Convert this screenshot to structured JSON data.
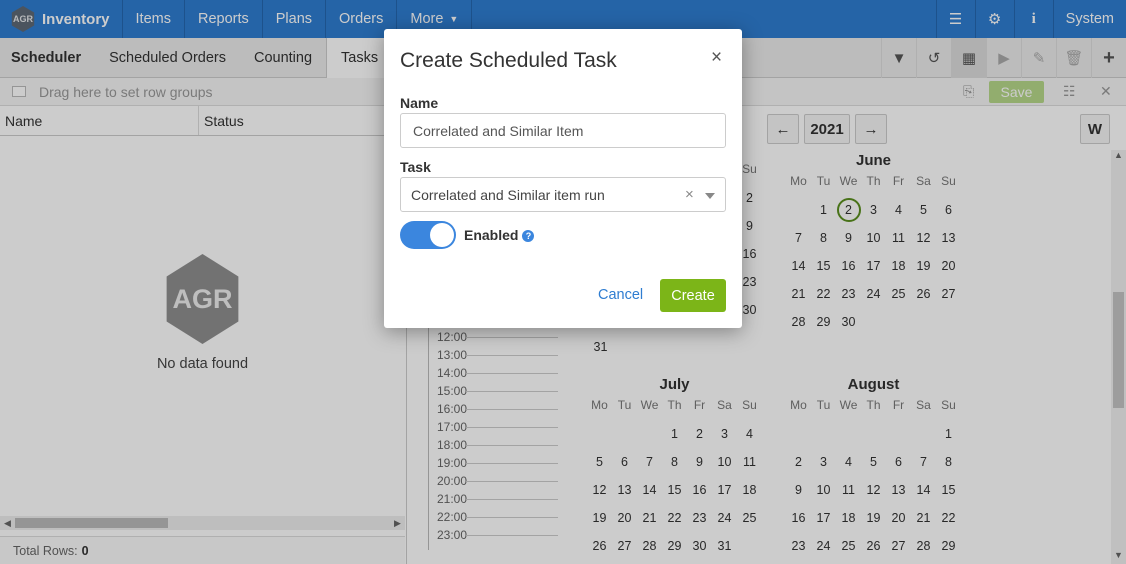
{
  "nav": {
    "logo": "AGR",
    "app": "Inventory",
    "items": [
      "Items",
      "Reports",
      "Plans",
      "Orders",
      "More"
    ],
    "system": "System",
    "icons": [
      "list-icon",
      "gear-icon",
      "info-icon"
    ]
  },
  "subnav": {
    "tabs": [
      "Scheduler",
      "Scheduled Orders",
      "Counting",
      "Tasks"
    ],
    "active_tab": "Tasks",
    "tools": [
      "filter-icon",
      "history-icon",
      "calendar-icon",
      "play-icon",
      "edit-icon",
      "delete-icon",
      "add-icon"
    ]
  },
  "grid": {
    "group_hint": "Drag here to set row groups",
    "columns": [
      "Name",
      "Status"
    ],
    "empty_logo": "AGR",
    "empty_text": "No data found",
    "total_label": "Total Rows:",
    "total_value": "0"
  },
  "calendar": {
    "save_label": "Save",
    "year": "2021",
    "view_button": "W",
    "prev_arrow": "←",
    "next_arrow": "→",
    "times": [
      "12:00",
      "13:00",
      "14:00",
      "15:00",
      "16:00",
      "17:00",
      "18:00",
      "19:00",
      "20:00",
      "21:00",
      "22:00",
      "23:00"
    ],
    "dow": [
      "Mo",
      "Tu",
      "We",
      "Th",
      "Fr",
      "Sa",
      "Su"
    ],
    "partial_col": {
      "header": "Su",
      "days": [
        "2",
        "9",
        "16",
        "23",
        "30"
      ],
      "last": "31"
    },
    "months": [
      {
        "name": "June",
        "offset": 1,
        "days": 30,
        "today": 2
      },
      {
        "name": "July",
        "offset": 3,
        "days": 31
      },
      {
        "name": "August",
        "offset": 6,
        "days": 31
      }
    ]
  },
  "modal": {
    "title": "Create Scheduled Task",
    "close": "×",
    "name_label": "Name",
    "name_value": "Correlated and Similar Item",
    "task_label": "Task",
    "task_value": "Correlated and Similar item run",
    "clear": "×",
    "enabled_label": "Enabled",
    "enabled": true,
    "help": "?",
    "cancel": "Cancel",
    "create": "Create"
  }
}
